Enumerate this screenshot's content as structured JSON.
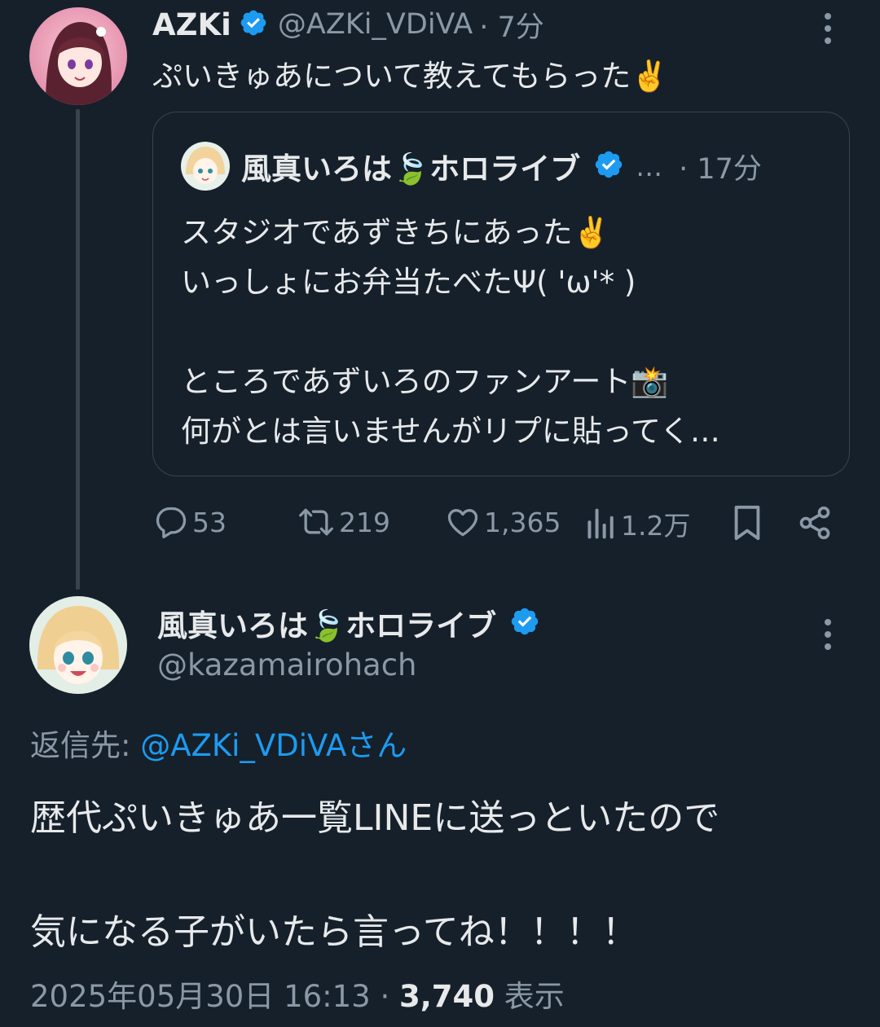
{
  "tweet1": {
    "name": "AZKi",
    "handle": "@AZKi_VDiVA",
    "time": "· 7分",
    "text": "ぷいきゅあについて教えてもらった✌️",
    "quote": {
      "name": "風真いろは🍃ホロライブ",
      "ellipsis": "…",
      "time": "· 17分",
      "line1": "スタジオであずきちにあった✌️",
      "line2": "いっしょにお弁当たべたΨ( 'ω'* )",
      "line3": "ところであずいろのファンアート📸",
      "line4": "何がとは言いませんがリプに貼ってく…"
    },
    "actions": {
      "replies": "53",
      "retweets": "219",
      "likes": "1,365",
      "views": "1.2万"
    }
  },
  "tweet2": {
    "name": "風真いろは🍃ホロライブ",
    "handle": "@kazamairohach",
    "reply_prefix": "返信先: ",
    "reply_target": "@AZKi_VDiVAさん",
    "line1": "歴代ぷいきゅあ一覧LINEに送っといたので",
    "line2": "気になる子がいたら言ってね！！！！",
    "timestamp": "2025年05月30日 16:13 · ",
    "views_count": "3,740",
    "views_label": " 表示"
  },
  "colors": {
    "background": "#15202b",
    "text": "#e7e9ea",
    "muted": "#8b98a5",
    "link": "#1d9bf0",
    "verified": "#1d9bf0"
  },
  "icons": [
    "verified-badge-icon",
    "more-icon",
    "reply-icon",
    "retweet-icon",
    "like-icon",
    "views-icon",
    "bookmark-icon",
    "share-icon"
  ]
}
